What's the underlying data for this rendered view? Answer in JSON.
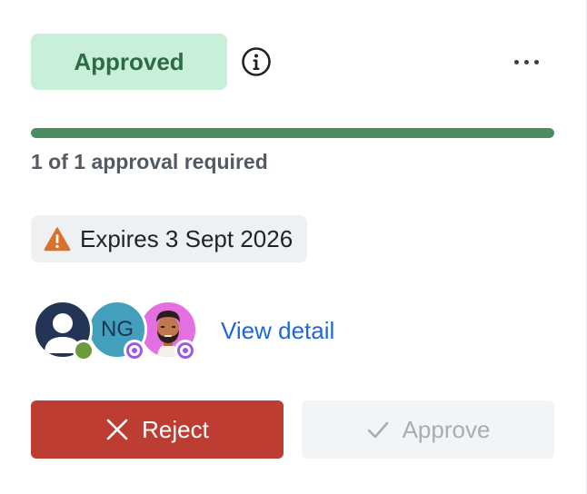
{
  "status": {
    "label": "Approved",
    "color": "#c8efd9",
    "text_color": "#2e6b45"
  },
  "header": {
    "info_icon": "info-icon",
    "more_icon": "more-horizontal-icon"
  },
  "approval": {
    "progress": 1.0,
    "text": "1 of 1 approval required",
    "fill_color": "#4c8a62"
  },
  "expiry": {
    "icon": "warning-icon",
    "text": "Expires 3 Sept 2026"
  },
  "approvers": [
    {
      "type": "default-avatar",
      "presence": "online"
    },
    {
      "initials": "NG",
      "presence": "ring"
    },
    {
      "type": "photo-avatar",
      "presence": "ring"
    }
  ],
  "links": {
    "view_detail": "View detail"
  },
  "actions": {
    "reject_label": "Reject",
    "approve_label": "Approve",
    "reject_color": "#be3d33",
    "approve_disabled": true
  }
}
